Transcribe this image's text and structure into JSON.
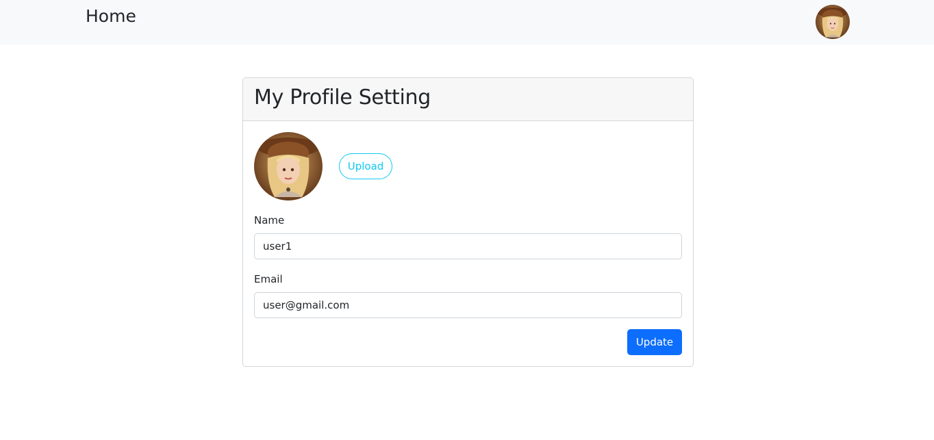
{
  "navbar": {
    "brand": "Home",
    "avatar_icon": "user-avatar-icon"
  },
  "profile_card": {
    "title": "My Profile Setting",
    "avatar_icon": "profile-avatar-icon",
    "upload_label": "Upload",
    "name": {
      "label": "Name",
      "value": "user1"
    },
    "email": {
      "label": "Email",
      "value": "user@gmail.com"
    },
    "update_label": "Update"
  },
  "colors": {
    "navbar_bg": "#f8f9fa",
    "primary": "#0d6efd",
    "info": "#0dcaf0",
    "card_header_bg": "#f7f7f7",
    "border": "#d3d6d9"
  }
}
